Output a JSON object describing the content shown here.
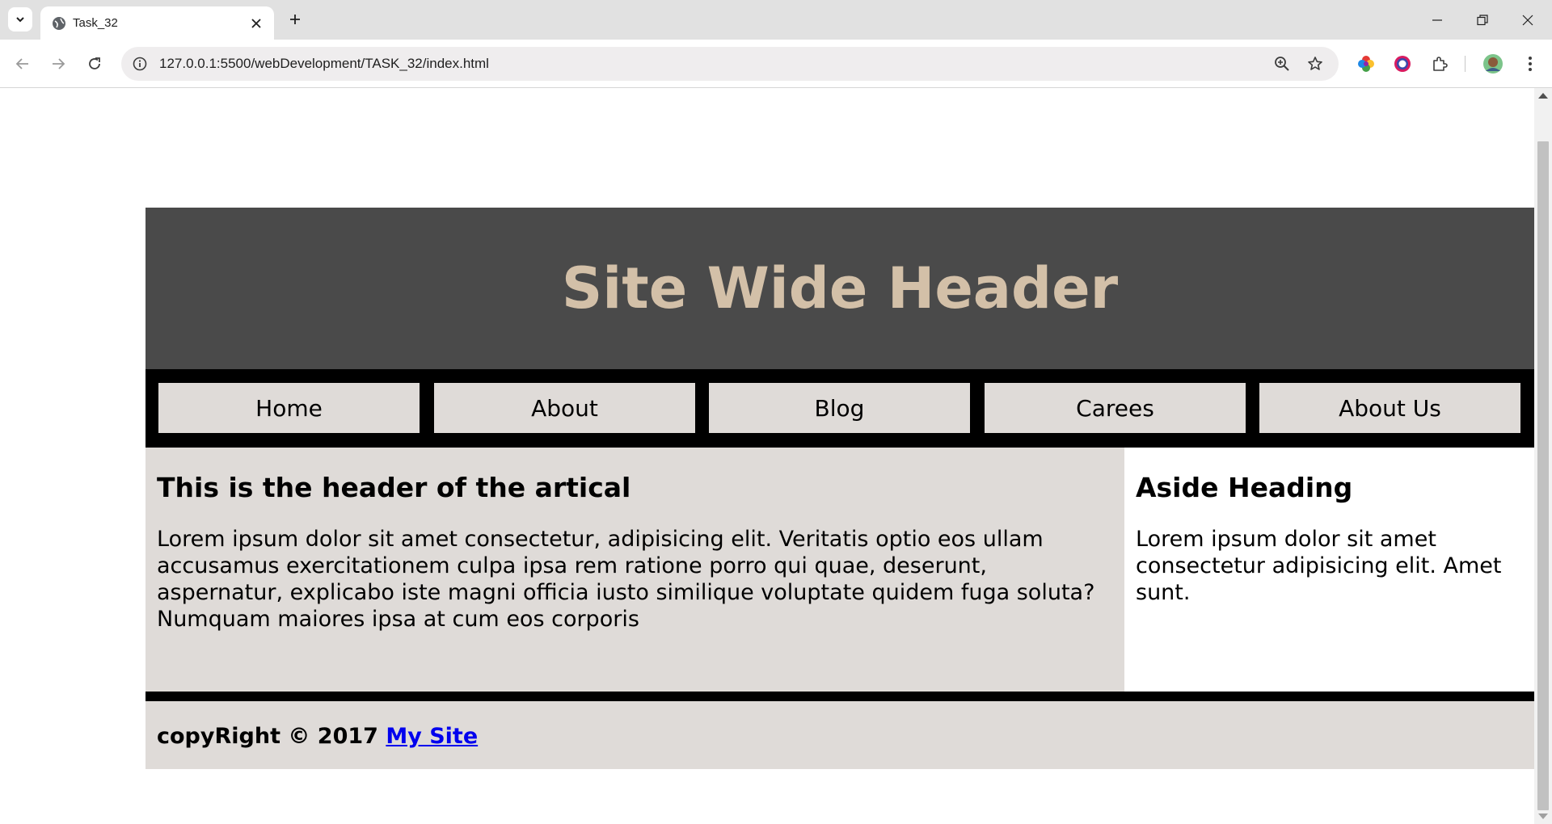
{
  "browser": {
    "tab_title": "Task_32",
    "url": "127.0.0.1:5500/webDevelopment/TASK_32/index.html"
  },
  "site": {
    "header_title": "Site Wide Header",
    "nav": [
      "Home",
      "About",
      "Blog",
      "Carees",
      "About Us"
    ],
    "article": {
      "heading": "This is the header of the artical",
      "body": "Lorem ipsum dolor sit amet consectetur, adipisicing elit. Veritatis optio eos ullam accusamus exercitationem culpa ipsa rem ratione porro qui quae, deserunt, aspernatur, explicabo iste magni officia iusto similique voluptate quidem fuga soluta? Numquam maiores ipsa at cum eos corporis"
    },
    "aside": {
      "heading": "Aside Heading",
      "body": "Lorem ipsum dolor sit amet consectetur adipisicing elit. Amet sunt."
    },
    "footer": {
      "text": "copyRight © 2017",
      "link": "My Site"
    }
  },
  "colors": {
    "header_bg": "#4a4a4a",
    "header_text": "#d3c0a8",
    "nav_bg": "#000000",
    "nav_item_bg": "#dfdbd8",
    "article_bg": "#dfdbd8",
    "link": "#0000ee"
  },
  "icons": [
    "tab-list-icon",
    "globe-icon",
    "close-icon",
    "plus-icon",
    "minimize-icon",
    "restore-icon",
    "back-icon",
    "forward-icon",
    "reload-icon",
    "site-info-icon",
    "zoom-icon",
    "star-icon",
    "extension-icon",
    "avatar"
  ]
}
